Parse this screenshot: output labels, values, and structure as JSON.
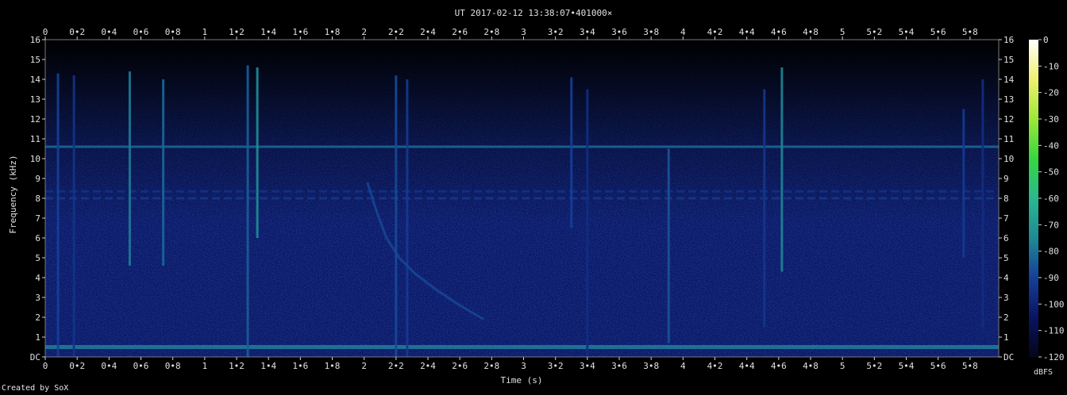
{
  "credit": "Created by SoX",
  "chart_data": {
    "type": "heatmap",
    "title": "UT 2017-02-12 13:38:07•401000×",
    "xlabel": "Time (s)",
    "ylabel": "Frequency (kHz)",
    "xlim": [
      0,
      5.98
    ],
    "ylim": [
      0,
      16
    ],
    "x_ticks": [
      {
        "v": 0,
        "label": "0"
      },
      {
        "v": 0.2,
        "label": "0•2"
      },
      {
        "v": 0.4,
        "label": "0•4"
      },
      {
        "v": 0.6,
        "label": "0•6"
      },
      {
        "v": 0.8,
        "label": "0•8"
      },
      {
        "v": 1,
        "label": "1"
      },
      {
        "v": 1.2,
        "label": "1•2"
      },
      {
        "v": 1.4,
        "label": "1•4"
      },
      {
        "v": 1.6,
        "label": "1•6"
      },
      {
        "v": 1.8,
        "label": "1•8"
      },
      {
        "v": 2,
        "label": "2"
      },
      {
        "v": 2.2,
        "label": "2•2"
      },
      {
        "v": 2.4,
        "label": "2•4"
      },
      {
        "v": 2.6,
        "label": "2•6"
      },
      {
        "v": 2.8,
        "label": "2•8"
      },
      {
        "v": 3,
        "label": "3"
      },
      {
        "v": 3.2,
        "label": "3•2"
      },
      {
        "v": 3.4,
        "label": "3•4"
      },
      {
        "v": 3.6,
        "label": "3•6"
      },
      {
        "v": 3.8,
        "label": "3•8"
      },
      {
        "v": 4,
        "label": "4"
      },
      {
        "v": 4.2,
        "label": "4•2"
      },
      {
        "v": 4.4,
        "label": "4•4"
      },
      {
        "v": 4.6,
        "label": "4•6"
      },
      {
        "v": 4.8,
        "label": "4•8"
      },
      {
        "v": 5,
        "label": "5"
      },
      {
        "v": 5.2,
        "label": "5•2"
      },
      {
        "v": 5.4,
        "label": "5•4"
      },
      {
        "v": 5.6,
        "label": "5•6"
      },
      {
        "v": 5.8,
        "label": "5•8"
      }
    ],
    "y_ticks": [
      {
        "v": 0,
        "label": "DC"
      },
      {
        "v": 1,
        "label": "1"
      },
      {
        "v": 2,
        "label": "2"
      },
      {
        "v": 3,
        "label": "3"
      },
      {
        "v": 4,
        "label": "4"
      },
      {
        "v": 5,
        "label": "5"
      },
      {
        "v": 6,
        "label": "6"
      },
      {
        "v": 7,
        "label": "7"
      },
      {
        "v": 8,
        "label": "8"
      },
      {
        "v": 9,
        "label": "9"
      },
      {
        "v": 10,
        "label": "10"
      },
      {
        "v": 11,
        "label": "11"
      },
      {
        "v": 12,
        "label": "12"
      },
      {
        "v": 13,
        "label": "13"
      },
      {
        "v": 14,
        "label": "14"
      },
      {
        "v": 15,
        "label": "15"
      },
      {
        "v": 16,
        "label": "16"
      }
    ],
    "colorbar": {
      "label": "dBFS",
      "range": [
        -120,
        0
      ],
      "ticks": [
        {
          "v": 0,
          "label": "0"
        },
        {
          "v": -10,
          "label": "-10"
        },
        {
          "v": -20,
          "label": "-20"
        },
        {
          "v": -30,
          "label": "-30"
        },
        {
          "v": -40,
          "label": "-40"
        },
        {
          "v": -50,
          "label": "-50"
        },
        {
          "v": -60,
          "label": "-60"
        },
        {
          "v": -70,
          "label": "-70"
        },
        {
          "v": -80,
          "label": "-80"
        },
        {
          "v": -90,
          "label": "-90"
        },
        {
          "v": -100,
          "label": "-100"
        },
        {
          "v": -110,
          "label": "-110"
        },
        {
          "v": -120,
          "label": "-120"
        }
      ],
      "stops": [
        "#05051a",
        "#0a1460",
        "#154098",
        "#1f8a96",
        "#2ab890",
        "#36d640",
        "#9ee83a",
        "#f0f070",
        "#ffffff"
      ]
    },
    "background_level_dbfs": -105,
    "horizontal_lines": [
      {
        "freq_khz": 10.6,
        "level_dbfs": -82
      },
      {
        "freq_khz": 8.35,
        "level_dbfs": -95,
        "dashed": true
      },
      {
        "freq_khz": 8.0,
        "level_dbfs": -93,
        "dashed": true
      },
      {
        "freq_khz": 0.5,
        "level_dbfs": -78
      }
    ],
    "vertical_impulses": [
      {
        "time_s": 0.08,
        "f_low_khz": 0,
        "f_high_khz": 14.3,
        "level_dbfs": -90
      },
      {
        "time_s": 0.18,
        "f_low_khz": 0,
        "f_high_khz": 14.2,
        "level_dbfs": -94
      },
      {
        "time_s": 0.53,
        "f_low_khz": 4.6,
        "f_high_khz": 14.4,
        "level_dbfs": -78
      },
      {
        "time_s": 0.74,
        "f_low_khz": 4.6,
        "f_high_khz": 14.0,
        "level_dbfs": -82
      },
      {
        "time_s": 1.27,
        "f_low_khz": 0,
        "f_high_khz": 14.7,
        "level_dbfs": -84
      },
      {
        "time_s": 1.33,
        "f_low_khz": 6.0,
        "f_high_khz": 14.6,
        "level_dbfs": -74
      },
      {
        "time_s": 2.2,
        "f_low_khz": 0,
        "f_high_khz": 14.2,
        "level_dbfs": -88
      },
      {
        "time_s": 2.27,
        "f_low_khz": 0,
        "f_high_khz": 14.0,
        "level_dbfs": -92
      },
      {
        "time_s": 3.3,
        "f_low_khz": 6.5,
        "f_high_khz": 14.1,
        "level_dbfs": -90
      },
      {
        "time_s": 3.4,
        "f_low_khz": 0,
        "f_high_khz": 13.5,
        "level_dbfs": -96
      },
      {
        "time_s": 3.91,
        "f_low_khz": 0.7,
        "f_high_khz": 10.5,
        "level_dbfs": -86
      },
      {
        "time_s": 4.51,
        "f_low_khz": 1.5,
        "f_high_khz": 13.5,
        "level_dbfs": -93
      },
      {
        "time_s": 4.62,
        "f_low_khz": 4.3,
        "f_high_khz": 14.6,
        "level_dbfs": -76
      },
      {
        "time_s": 5.76,
        "f_low_khz": 5.0,
        "f_high_khz": 12.5,
        "level_dbfs": -92
      },
      {
        "time_s": 5.88,
        "f_low_khz": 1.5,
        "f_high_khz": 14.0,
        "level_dbfs": -96
      }
    ],
    "dispersive_whistler": {
      "level_dbfs": -88,
      "points": [
        [
          2.02,
          8.8
        ],
        [
          2.08,
          7.3
        ],
        [
          2.14,
          6.0
        ],
        [
          2.22,
          5.0
        ],
        [
          2.32,
          4.2
        ],
        [
          2.45,
          3.4
        ],
        [
          2.6,
          2.6
        ],
        [
          2.75,
          1.9
        ]
      ]
    }
  }
}
